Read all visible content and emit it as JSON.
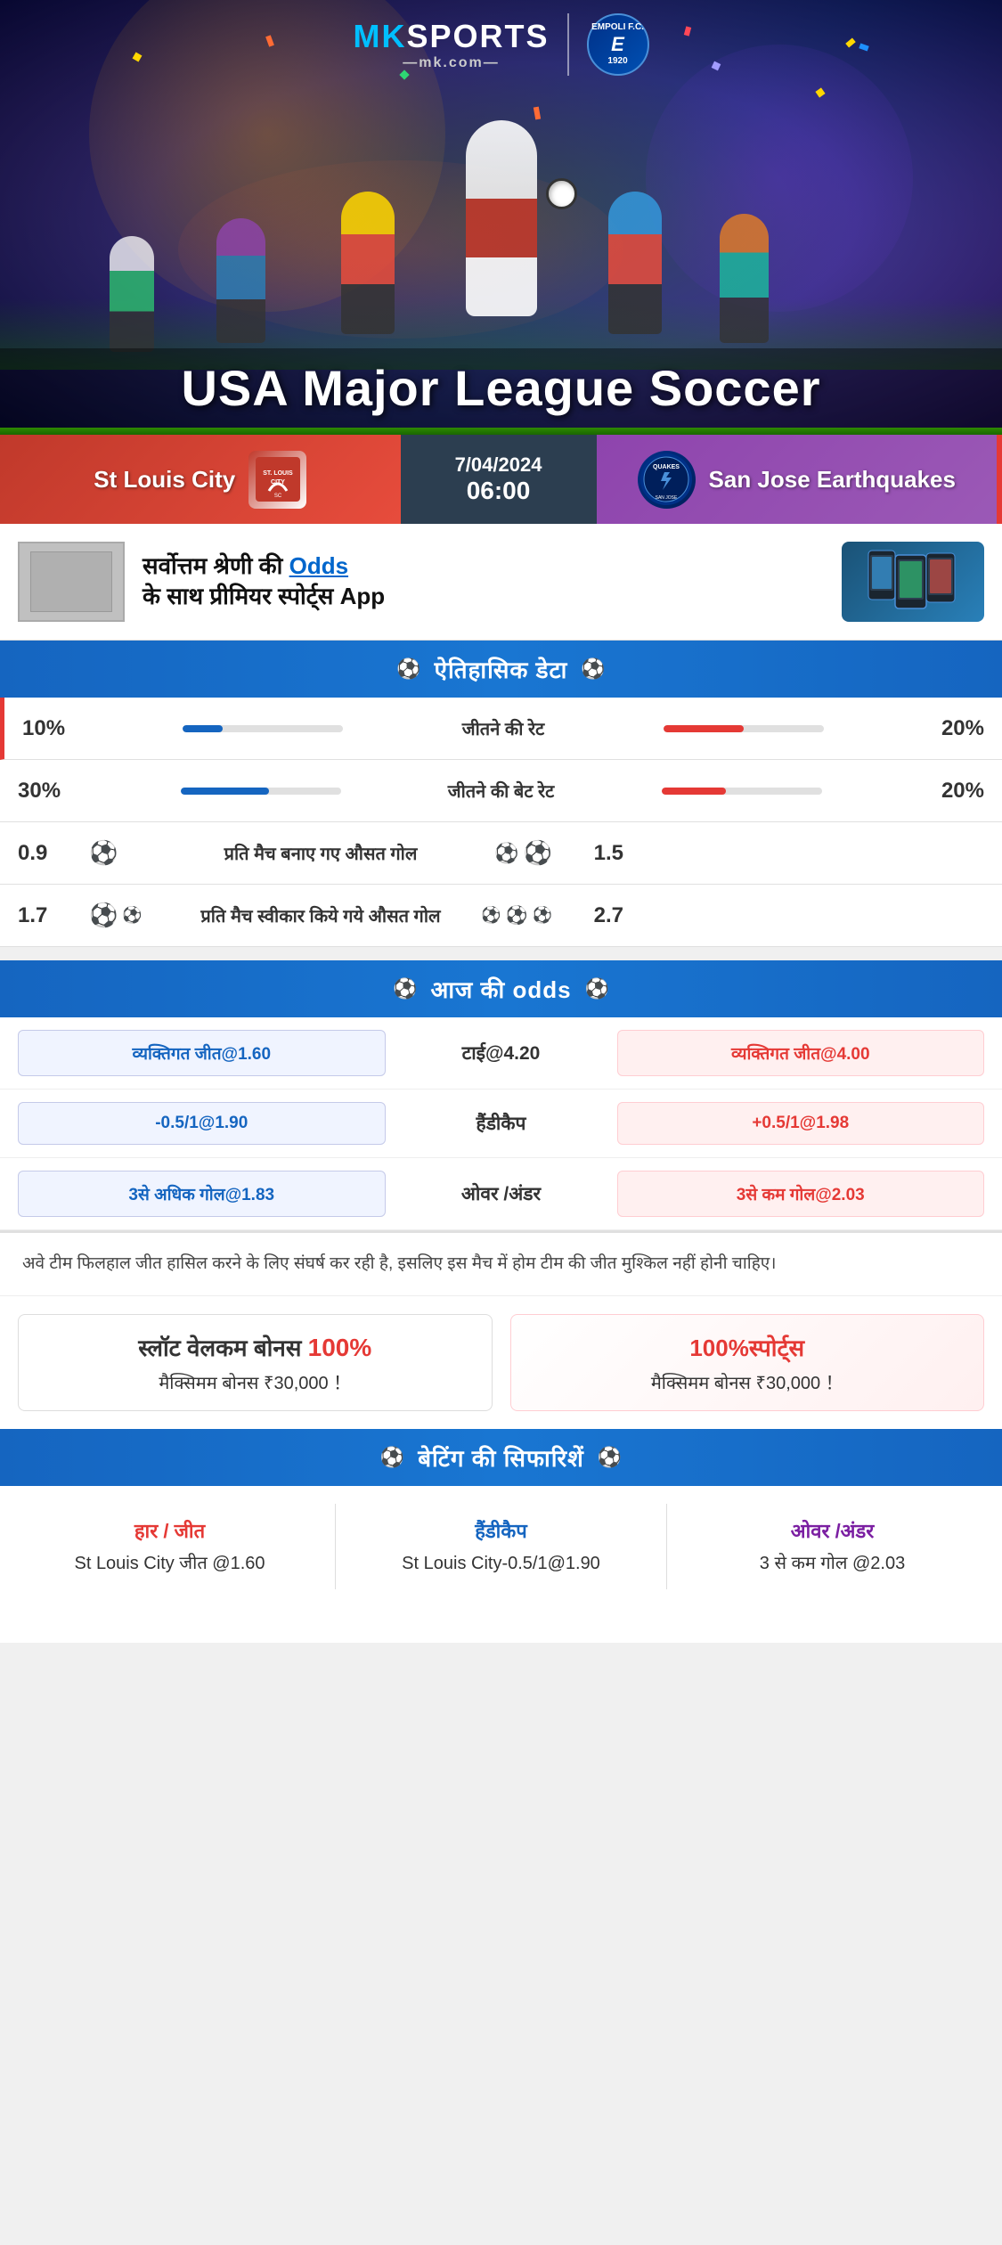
{
  "brand": {
    "mk_label": "MK",
    "sports_label": "SPORTS",
    "domain_label": "—mk.com—",
    "empoli_label": "EMPOLI F.C.\n1920"
  },
  "hero": {
    "title": "USA Major League Soccer"
  },
  "match": {
    "team_left": "St Louis City",
    "team_right": "San Jose Earthquakes",
    "team_right_abbr": "QUAKES",
    "date": "7/04/2024",
    "time": "06:00"
  },
  "promo": {
    "text_line1": "सर्वोत्तम श्रेणी की",
    "text_odds": "Odds",
    "text_line2": "के साथ प्रीमियर स्पोर्ट्स",
    "text_app": "App"
  },
  "sections": {
    "historical_title": "ऐतिहासिक डेटा",
    "odds_title": "आज की odds",
    "recommendations_title": "बेटिंग की सिफारिशें"
  },
  "stats": [
    {
      "label": "जीतने की रेट",
      "left_val": "10%",
      "right_val": "20%",
      "left_pct": 25,
      "right_pct": 50,
      "type": "bar"
    },
    {
      "label": "जीतने की बेट रेट",
      "left_val": "30%",
      "right_val": "20%",
      "left_pct": 55,
      "right_pct": 40,
      "type": "bar"
    },
    {
      "label": "प्रति मैच बनाए गए औसत गोल",
      "left_val": "0.9",
      "right_val": "1.5",
      "left_balls": 1,
      "right_balls": 2,
      "type": "ball"
    },
    {
      "label": "प्रति मैच स्वीकार किये गये औसत गोल",
      "left_val": "1.7",
      "right_val": "2.7",
      "left_balls": 2,
      "right_balls": 3,
      "type": "ball"
    }
  ],
  "odds": [
    {
      "left_label": "व्यक्तिगत जीत@1.60",
      "center_label": "टाई@4.20",
      "right_label": "व्यक्तिगत जीत@4.00",
      "right_red": true
    },
    {
      "left_label": "-0.5/1@1.90",
      "center_label": "हैंडीकैप",
      "right_label": "+0.5/1@1.98",
      "right_red": true
    },
    {
      "left_label": "3से अधिक गोल@1.83",
      "center_label": "ओवर /अंडर",
      "right_label": "3से कम गोल@2.03",
      "right_red": true
    }
  ],
  "info_text": "अवे टीम फिलहाल जीत हासिल करने के लिए संघर्ष कर रही है, इसलिए इस मैच में होम टीम की जीत मुश्किल नहीं होनी चाहिए।",
  "bonus": [
    {
      "title": "स्लॉट वेलकम बोनस",
      "pct": "100%",
      "subtitle": "मैक्सिमम बोनस ₹30,000 ！"
    },
    {
      "title": "100%स्पोर्ट्स",
      "subtitle": "मैक्सिमम बोनस  ₹30,000 ！"
    }
  ],
  "recommendations": [
    {
      "type": "हार / जीत",
      "type_color": "red",
      "value": "St Louis City जीत @1.60"
    },
    {
      "type": "हैंडीकैप",
      "type_color": "blue",
      "value": "St Louis City-0.5/1@1.90"
    },
    {
      "type": "ओवर /अंडर",
      "type_color": "purple",
      "value": "3 से कम गोल @2.03"
    }
  ]
}
